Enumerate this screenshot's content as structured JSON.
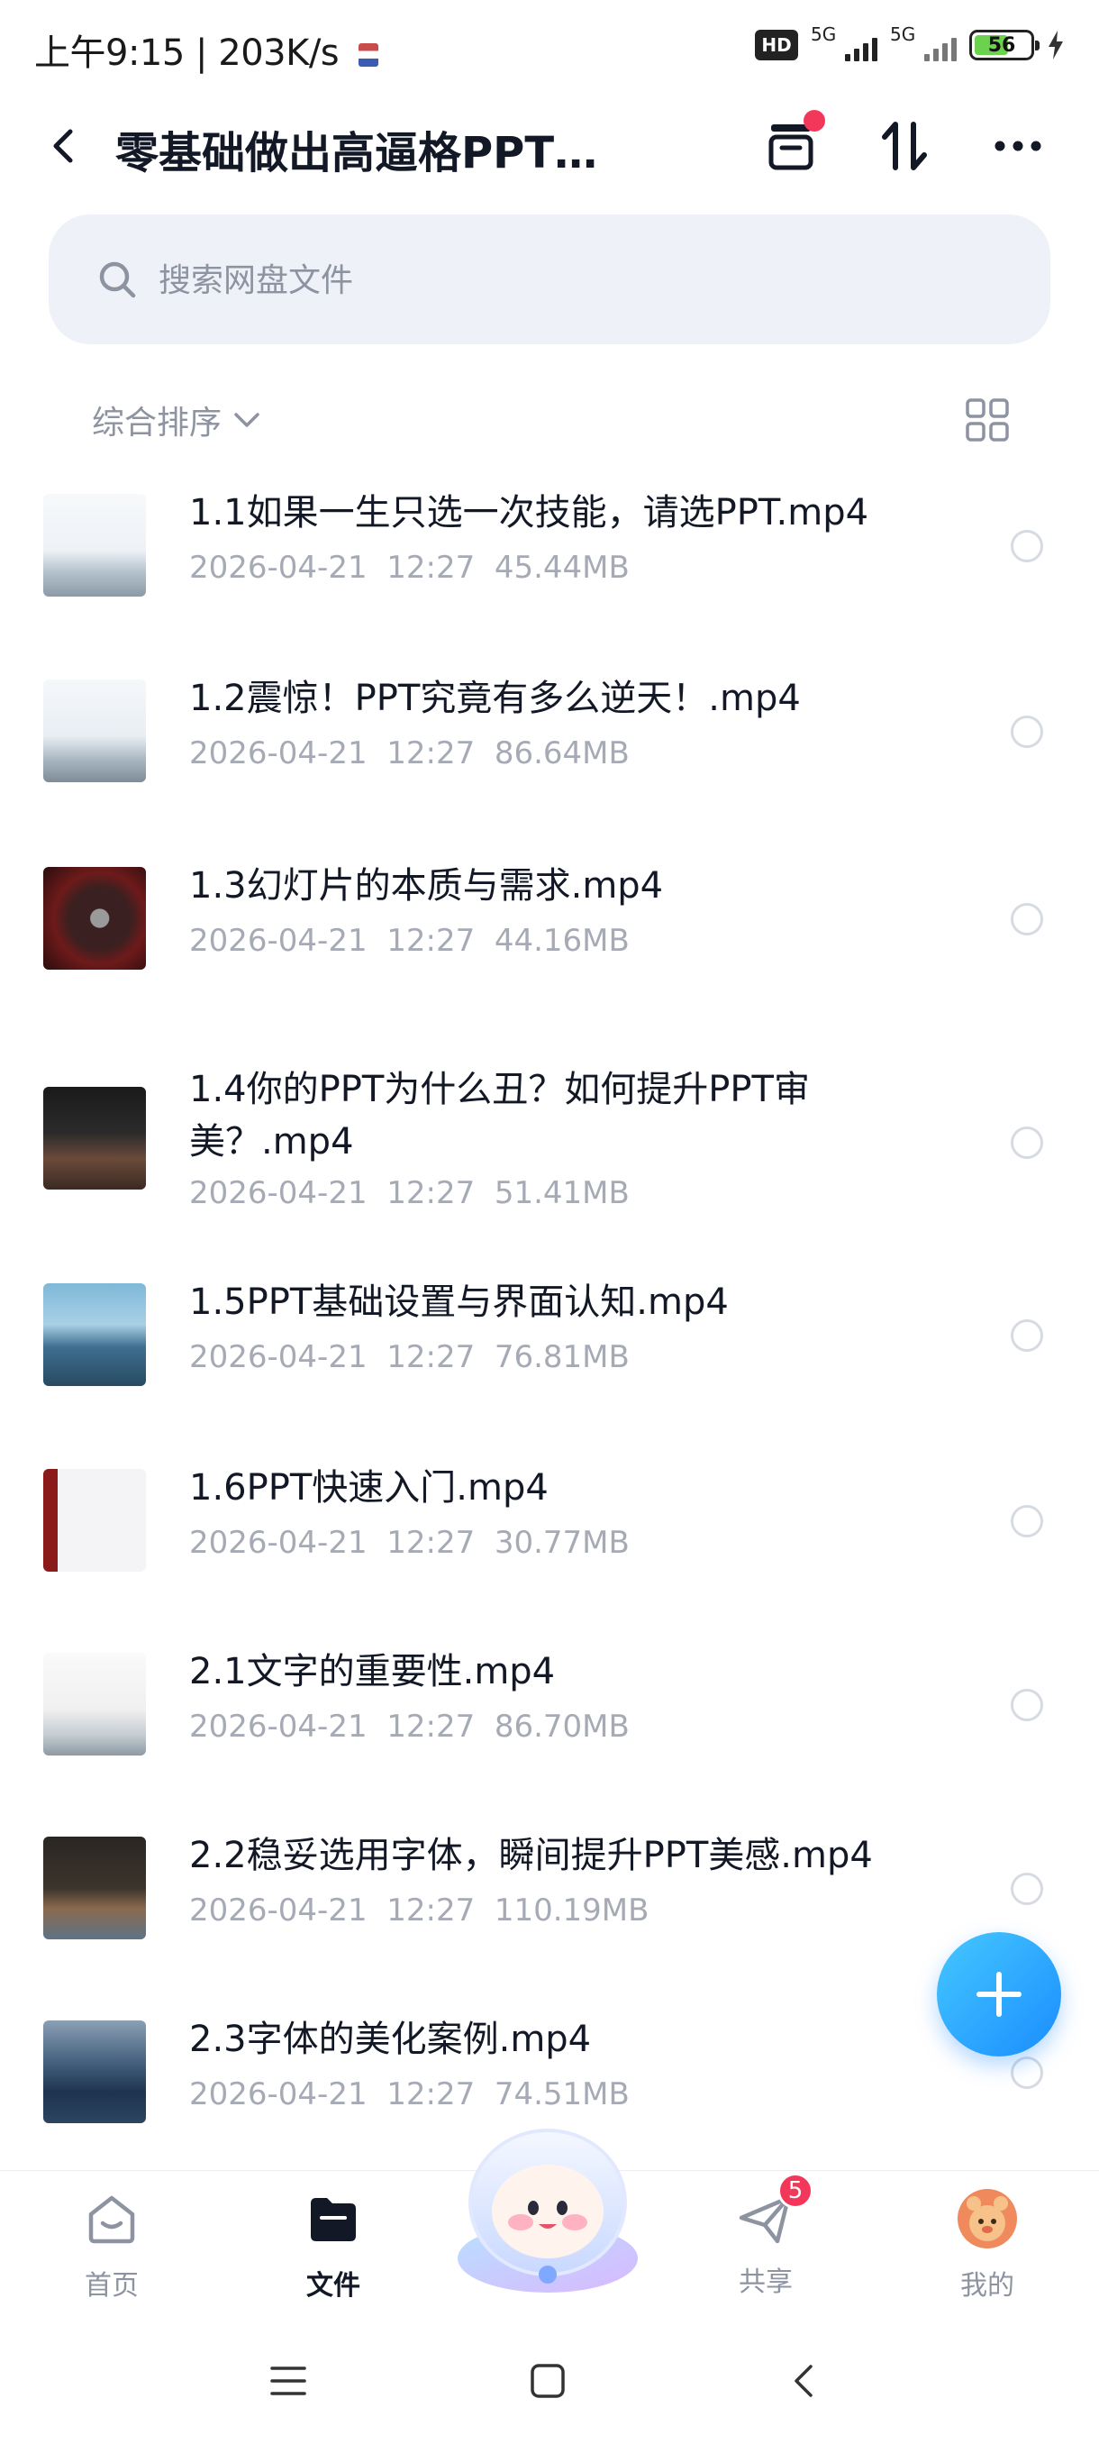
{
  "status_bar": {
    "time": "上午9:15",
    "speed": "203K/s",
    "hd_label": "HD",
    "network_1": "5G",
    "network_2": "5G",
    "battery": "56"
  },
  "header": {
    "title": "零基础做出高逼格PPT，..."
  },
  "search": {
    "placeholder": "搜索网盘文件"
  },
  "sort": {
    "label": "综合排序"
  },
  "files": [
    {
      "name": "1.1如果一生只选一次技能，请选PPT.mp4",
      "date": "2026-04-21",
      "time": "12:27",
      "size": "45.44MB"
    },
    {
      "name": "1.2震惊！PPT究竟有多么逆天！.mp4",
      "date": "2026-04-21",
      "time": "12:27",
      "size": "86.64MB"
    },
    {
      "name": "1.3幻灯片的本质与需求.mp4",
      "date": "2026-04-21",
      "time": "12:27",
      "size": "44.16MB"
    },
    {
      "name": "1.4你的PPT为什么丑？如何提升PPT审美？.mp4",
      "date": "2026-04-21",
      "time": "12:27",
      "size": "51.41MB"
    },
    {
      "name": "1.5PPT基础设置与界面认知.mp4",
      "date": "2026-04-21",
      "time": "12:27",
      "size": "76.81MB"
    },
    {
      "name": "1.6PPT快速入门.mp4",
      "date": "2026-04-21",
      "time": "12:27",
      "size": "30.77MB"
    },
    {
      "name": "2.1文字的重要性.mp4",
      "date": "2026-04-21",
      "time": "12:27",
      "size": "86.70MB"
    },
    {
      "name": "2.2稳妥选用字体，瞬间提升PPT美感.mp4",
      "date": "2026-04-21",
      "time": "12:27",
      "size": "110.19MB"
    },
    {
      "name": "2.3字体的美化案例.mp4",
      "date": "2026-04-21",
      "time": "12:27",
      "size": "74.51MB"
    }
  ],
  "bottom_nav": {
    "home": "首页",
    "files": "文件",
    "share": "共享",
    "share_badge": "5",
    "mine": "我的"
  },
  "colors": {
    "accent": "#1a8dff",
    "badge": "#f2375a",
    "muted_text": "#8d93a0"
  }
}
